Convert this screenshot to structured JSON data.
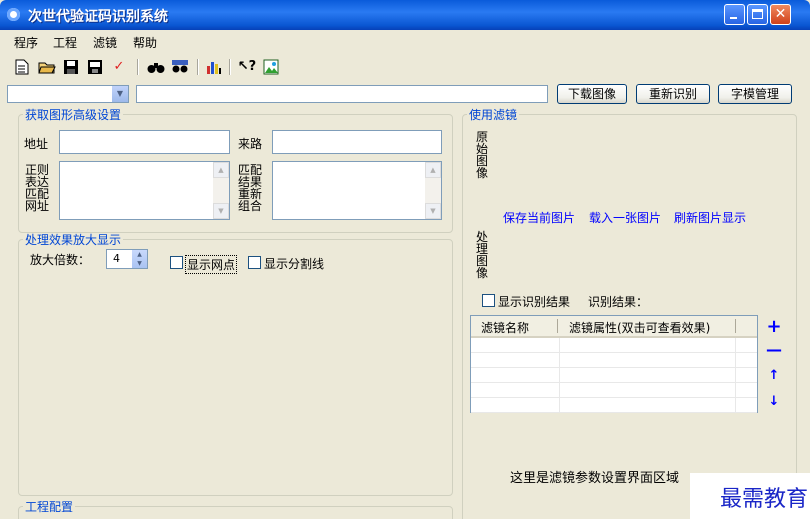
{
  "window": {
    "title": "次世代验证码识别系统"
  },
  "menu": [
    "程序",
    "工程",
    "滤镜",
    "帮助"
  ],
  "toolbar": {
    "icons": [
      "new-file-icon",
      "open-folder-icon",
      "save-icon",
      "save-all-icon",
      "check-icon",
      "binoculars-icon",
      "find-replace-icon",
      "chart-icon",
      "help-pointer-icon",
      "image-icon"
    ]
  },
  "topbar": {
    "url_value": "",
    "combo_value": "",
    "btn_download": "下载图像",
    "btn_recognize": "重新识别",
    "btn_font": "字模管理"
  },
  "advanced": {
    "legend": "获取图形高级设置",
    "address_label": "地址",
    "referer_label": "来路",
    "regex_label": "正则表达匹配网址",
    "match_label": "匹配结果重新组合"
  },
  "zoom": {
    "legend": "处理效果放大显示",
    "factor_label": "放大倍数：",
    "factor_value": "4",
    "show_grid": "显示网点",
    "show_split": "显示分割线"
  },
  "project": {
    "legend": "工程配置"
  },
  "filters": {
    "legend": "使用滤镜",
    "original_label": "原始图像",
    "processed_label": "处理图像",
    "links": [
      "保存当前图片",
      "载入一张图片",
      "刷新图片显示"
    ],
    "show_result": "显示识别结果",
    "result_label": "识别结果：",
    "columns": [
      "滤镜名称",
      "滤镜属性(双击可查看效果)"
    ],
    "side_controls": [
      "+",
      "—",
      "↑",
      "↓"
    ],
    "param_area_text": "这里是滤镜参数设置界面区域"
  },
  "watermark": "最需教育"
}
